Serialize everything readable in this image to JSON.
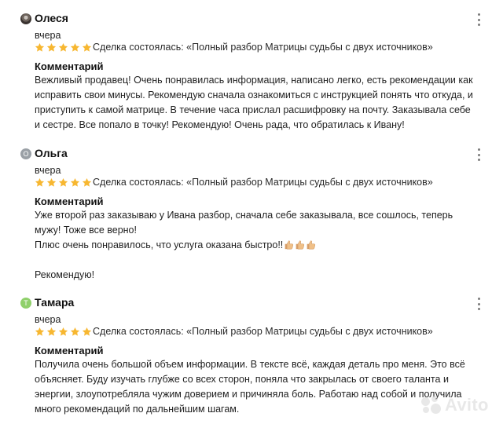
{
  "colors": {
    "star": "#f7b731",
    "avatar_olga": "#9aa0a6",
    "avatar_tamara": "#8fd06b"
  },
  "icons": {
    "more": "vertical-ellipsis-icon",
    "star": "star-icon",
    "thumbs_up": "thumbs-up-emoji"
  },
  "reviews": [
    {
      "author": "Олеся",
      "avatar_letter": "",
      "date": "вчера",
      "rating": 5,
      "deal": "Сделка состоялась: «Полный разбор Матрицы судьбы с двух источников»",
      "comment_title": "Комментарий",
      "lines": [
        "Вежливый продавец! Очень понравилась информация, написано легко, есть рекомендации как",
        "исправить свои минусы. Рекомендую сначала ознакомиться с инструкцией понять что откуда, и",
        "приступить к самой матрице. В течение часа прислал расшифровку на почту. Заказывала себе",
        "и сестре. Все попало в точку! Рекомендую! Очень рада, что обратилась к Ивану!"
      ]
    },
    {
      "author": "Ольга",
      "avatar_letter": "О",
      "date": "вчера",
      "rating": 5,
      "deal": "Сделка состоялась: «Полный разбор Матрицы судьбы с двух источников»",
      "comment_title": "Комментарий",
      "lines": [
        "Уже второй раз заказываю у Ивана разбор, сначала себе заказывала, все сошлось, теперь",
        "мужу! Тоже все верно!",
        "Плюс очень понравилось, что услуга оказана быстро!!",
        "",
        "Рекомендую!"
      ]
    },
    {
      "author": "Тамара",
      "avatar_letter": "Т",
      "date": "вчера",
      "rating": 5,
      "deal": "Сделка состоялась: «Полный разбор Матрицы судьбы с двух источников»",
      "comment_title": "Комментарий",
      "lines": [
        "Получила очень большой объем информации. В тексте всё, каждая деталь про меня. Это всё",
        "объясняет. Буду изучать глубже со всех сторон, поняла что закрылась от своего таланта и",
        "энергии, злоупотребляла чужим доверием и причиняла боль. Работаю над собой и получила",
        "много рекомендаций по дальнейшим шагам."
      ]
    }
  ],
  "watermark": "Avito"
}
